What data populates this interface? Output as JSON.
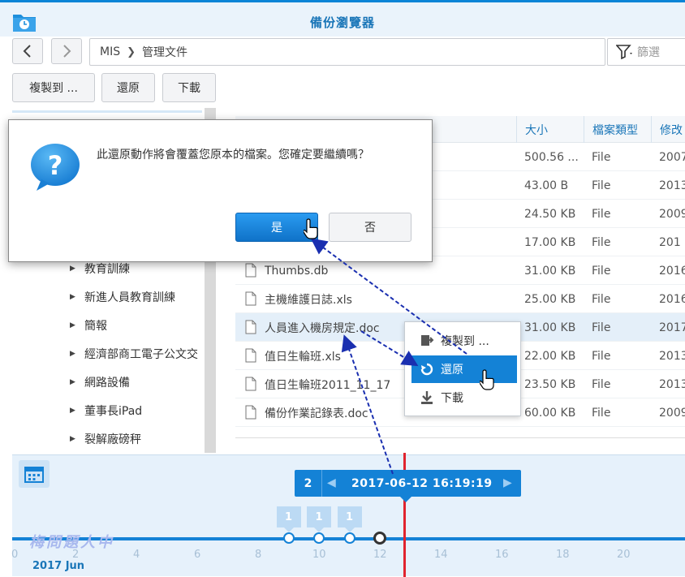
{
  "window": {
    "title": "備份瀏覽器"
  },
  "nav": {
    "path": [
      "MIS",
      "管理文件"
    ],
    "filter_placeholder": "篩選"
  },
  "toolbar": {
    "copy_label": "複製到 ...",
    "restore_label": "還原",
    "download_label": "下載"
  },
  "sidebar": {
    "items": [
      {
        "label": "教育訓練"
      },
      {
        "label": "新進人員教育訓練"
      },
      {
        "label": "簡報"
      },
      {
        "label": "經濟部商工電子公文交"
      },
      {
        "label": "網路設備"
      },
      {
        "label": "董事長iPad"
      },
      {
        "label": "裂解廠磅秤"
      }
    ]
  },
  "filelist": {
    "headers": {
      "size": "大小",
      "type": "檔案類型",
      "modified": "修改"
    },
    "rows": [
      {
        "name": "",
        "size": "500.56 ...",
        "type": "File",
        "modified": "2007"
      },
      {
        "name": "",
        "size": "43.00 B",
        "type": "File",
        "modified": "2013"
      },
      {
        "name": "",
        "size": "24.50 KB",
        "type": "File",
        "modified": "2009"
      },
      {
        "name": "",
        "size": "17.00 KB",
        "type": "File",
        "modified": "201"
      },
      {
        "name": "Thumbs.db",
        "size": "31.00 KB",
        "type": "File",
        "modified": "2016"
      },
      {
        "name": "主機維護日誌.xls",
        "size": "25.00 KB",
        "type": "File",
        "modified": "2016"
      },
      {
        "name": "人員進入機房規定.doc",
        "size": "31.00 KB",
        "type": "File",
        "modified": "2017"
      },
      {
        "name": "值日生輪班.xls",
        "size": "22.00 KB",
        "type": "File",
        "modified": "2013"
      },
      {
        "name": "值日生輪班2011_11_17",
        "size": "23.50 KB",
        "type": "File",
        "modified": "2013"
      },
      {
        "name": "備份作業記錄表.doc",
        "size": "60.00 KB",
        "type": "File",
        "modified": "2009"
      }
    ]
  },
  "context_menu": {
    "items": [
      {
        "label": "複製到 ..."
      },
      {
        "label": "還原"
      },
      {
        "label": "下載"
      }
    ]
  },
  "dialog": {
    "message": "此還原動作將會覆蓋您原本的檔案。您確定要繼續嗎？",
    "yes_label": "是",
    "no_label": "否"
  },
  "timeline": {
    "version_count": "2",
    "selected_datetime": "2017-06-12 16:19:19",
    "bubbles": [
      "1",
      "1",
      "1"
    ],
    "ticks": [
      "0",
      "2",
      "4",
      "6",
      "8",
      "10",
      "12",
      "14",
      "16",
      "18",
      "20"
    ],
    "month_label": "2017 Jun",
    "watermark": "梅問題人中"
  },
  "colors": {
    "accent": "#1482d6",
    "title_text": "#1a76b8",
    "marker_red": "#e0242e",
    "annotation_arrow": "#1a2fb0"
  }
}
